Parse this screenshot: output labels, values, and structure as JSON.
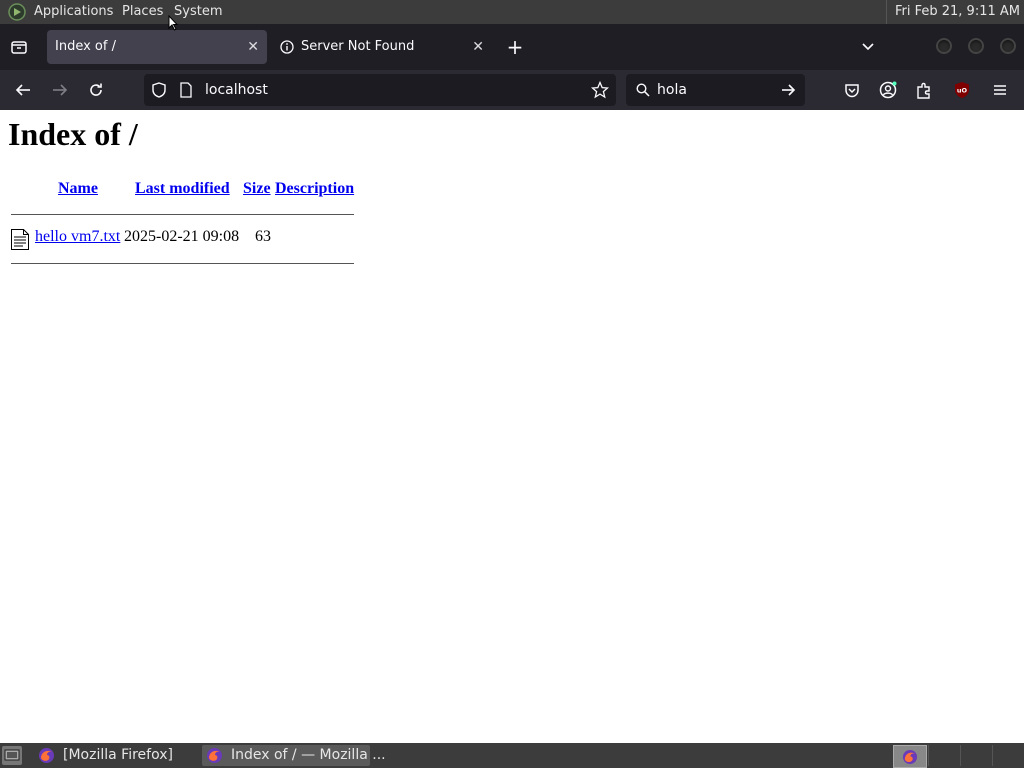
{
  "top_panel": {
    "menus": [
      "Applications",
      "Places",
      "System"
    ],
    "clock": "Fri Feb 21,  9:11 AM"
  },
  "tabs": [
    {
      "label": "Index of /",
      "active": true
    },
    {
      "label": "Server Not Found",
      "active": false
    }
  ],
  "navbar": {
    "url": "localhost",
    "search_value": "hola"
  },
  "page": {
    "title": "Index of /",
    "columns": [
      "Name",
      "Last modified",
      "Size",
      "Description"
    ],
    "rows": [
      {
        "name": "hello vm7.txt",
        "modified": "2025-02-21 09:08",
        "size": "63",
        "description": ""
      }
    ]
  },
  "taskbar": {
    "items": [
      {
        "label": "[Mozilla Firefox]",
        "active": false
      },
      {
        "label": "Index of / — Mozilla ...",
        "active": true
      }
    ]
  },
  "colors": {
    "link": "#0000ee",
    "tab_active": "#42414d",
    "toolbar": "#2b2a33",
    "panel": "#3c3c3c"
  }
}
